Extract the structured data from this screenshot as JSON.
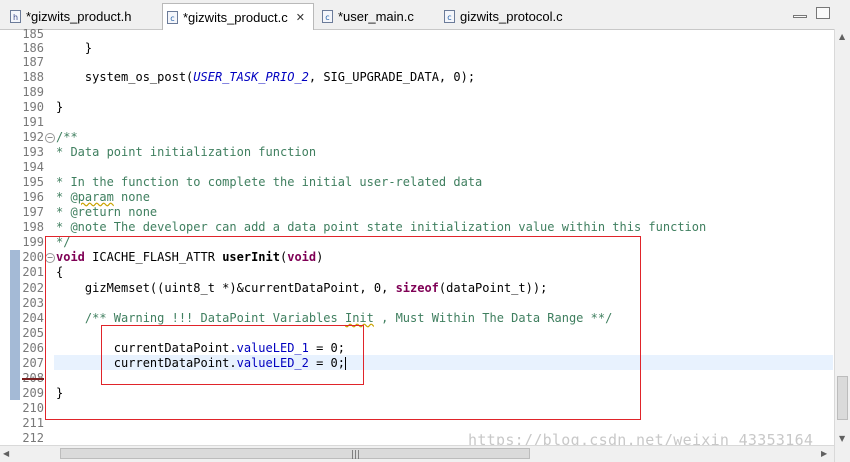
{
  "tabs": [
    {
      "label": "*gizwits_product.h",
      "icon": "h-file-icon",
      "active": false
    },
    {
      "label": "*gizwits_product.c",
      "icon": "c-file-icon",
      "active": true
    },
    {
      "label": "*user_main.c",
      "icon": "c-file-icon",
      "active": false
    },
    {
      "label": "gizwits_protocol.c",
      "icon": "c-file-icon",
      "active": false
    }
  ],
  "editor": {
    "lines": [
      {
        "n": "185",
        "text": ""
      },
      {
        "n": "186",
        "text": "    }"
      },
      {
        "n": "187",
        "text": ""
      },
      {
        "n": "188",
        "text": "    system_os_post(USER_TASK_PRIO_2, SIG_UPGRADE_DATA, 0);"
      },
      {
        "n": "189",
        "text": ""
      },
      {
        "n": "190",
        "text": "}"
      },
      {
        "n": "191",
        "text": ""
      },
      {
        "n": "192",
        "text": "/**"
      },
      {
        "n": "193",
        "text": "* Data point initialization function"
      },
      {
        "n": "194",
        "text": ""
      },
      {
        "n": "195",
        "text": "* In the function to complete the initial user-related data"
      },
      {
        "n": "196",
        "text": "* @param none"
      },
      {
        "n": "197",
        "text": "* @return none"
      },
      {
        "n": "198",
        "text": "* @note The developer can add a data point state initialization value within this function"
      },
      {
        "n": "199",
        "text": "*/"
      },
      {
        "n": "200",
        "text": "void ICACHE_FLASH_ATTR userInit(void)"
      },
      {
        "n": "201",
        "text": "{"
      },
      {
        "n": "202",
        "text": "    gizMemset((uint8_t *)&currentDataPoint, 0, sizeof(dataPoint_t));"
      },
      {
        "n": "203",
        "text": ""
      },
      {
        "n": "204",
        "text": "    /** Warning !!! DataPoint Variables Init , Must Within The Data Range **/"
      },
      {
        "n": "205",
        "text": ""
      },
      {
        "n": "206",
        "text": "        currentDataPoint.valueLED_1 = 0;"
      },
      {
        "n": "207",
        "text": "        currentDataPoint.valueLED_2 = 0;"
      },
      {
        "n": "208",
        "text": ""
      },
      {
        "n": "209",
        "text": "}"
      },
      {
        "n": "210",
        "text": ""
      },
      {
        "n": "211",
        "text": ""
      },
      {
        "n": "212",
        "text": ""
      }
    ]
  },
  "watermark": "https://blog.csdn.net/weixin_43353164",
  "colors": {
    "comment": "#3f7f5f",
    "keyword": "#7f0055",
    "constant": "#0000c0",
    "highlight_box": "#e0242a",
    "current_line": "#e8f2fe"
  }
}
